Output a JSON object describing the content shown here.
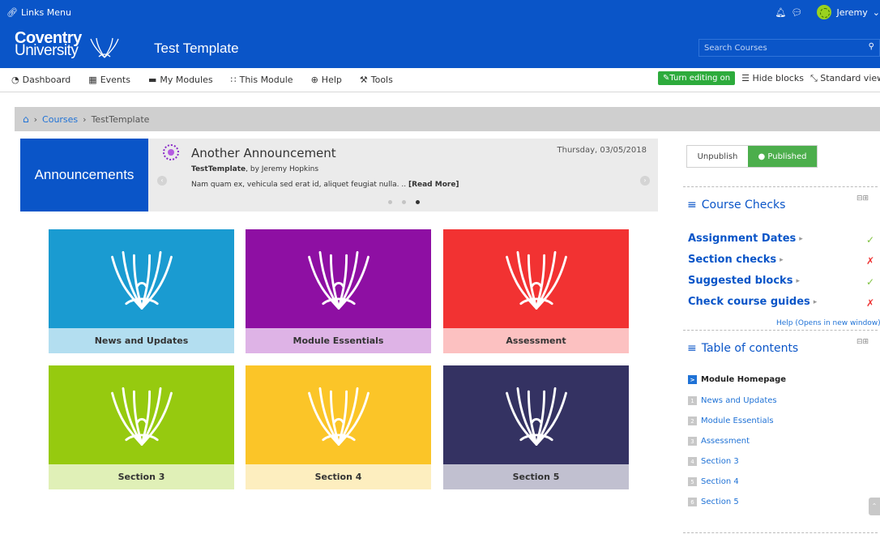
{
  "topbar": {
    "links_menu": "Links Menu",
    "user_name": "Jeremy",
    "icons": [
      "link-icon",
      "bell-icon",
      "chat-icon",
      "avatar",
      "chevron-down-icon"
    ]
  },
  "header": {
    "logo_line1": "Coventry",
    "logo_line2": "University",
    "site_title": "Test Template",
    "search_placeholder": "Search Courses"
  },
  "nav": {
    "items": [
      {
        "label": "Dashboard",
        "icon": "dashboard-icon"
      },
      {
        "label": "Events",
        "icon": "calendar-icon"
      },
      {
        "label": "My Modules",
        "icon": "briefcase-icon"
      },
      {
        "label": "This Module",
        "icon": "sitemap-icon"
      },
      {
        "label": "Help",
        "icon": "lifebuoy-icon"
      },
      {
        "label": "Tools",
        "icon": "wrench-icon"
      }
    ],
    "turn_editing_on": "Turn editing on",
    "hide_blocks": "Hide blocks",
    "standard_view": "Standard view"
  },
  "breadcrumb": {
    "items": [
      "Courses",
      "TestTemplate"
    ]
  },
  "announcements": {
    "heading": "Announcements",
    "title": "Another Announcement",
    "date": "Thursday, 03/05/2018",
    "course": "TestTemplate",
    "byline": ", by Jeremy Hopkins",
    "excerpt": "Nam quam ex, vehicula sed erat id, aliquet feugiat nulla. .. ",
    "read_more": "[Read More]",
    "active_slide": 3
  },
  "tiles": [
    {
      "label": "News and Updates",
      "color": "#1a9bd1",
      "label_bg": "#b3def0"
    },
    {
      "label": "Module Essentials",
      "color": "#8e0fa3",
      "label_bg": "#deb3e6"
    },
    {
      "label": "Assessment",
      "color": "#f23232",
      "label_bg": "#fcc1c1"
    },
    {
      "label": "Section 3",
      "color": "#96ca0f",
      "label_bg": "#e0f0b7"
    },
    {
      "label": "Section 4",
      "color": "#fbc528",
      "label_bg": "#fdeebf"
    },
    {
      "label": "Section 5",
      "color": "#343262",
      "label_bg": "#c1c0d0"
    }
  ],
  "publish": {
    "unpublish": "Unpublish",
    "published": "Published"
  },
  "course_checks": {
    "title": "Course Checks",
    "items": [
      {
        "label": "Assignment Dates",
        "status": "ok"
      },
      {
        "label": "Section checks",
        "status": "fail"
      },
      {
        "label": "Suggested blocks",
        "status": "ok"
      },
      {
        "label": "Check course guides",
        "status": "fail"
      }
    ],
    "help": "Help (Opens in new window)"
  },
  "toc": {
    "title": "Table of contents",
    "items": [
      {
        "num": ">",
        "label": "Module Homepage"
      },
      {
        "num": "1",
        "label": "News and Updates"
      },
      {
        "num": "2",
        "label": "Module Essentials"
      },
      {
        "num": "3",
        "label": "Assessment"
      },
      {
        "num": "4",
        "label": "Section 3"
      },
      {
        "num": "5",
        "label": "Section 4"
      },
      {
        "num": "6",
        "label": "Section 5"
      }
    ]
  }
}
